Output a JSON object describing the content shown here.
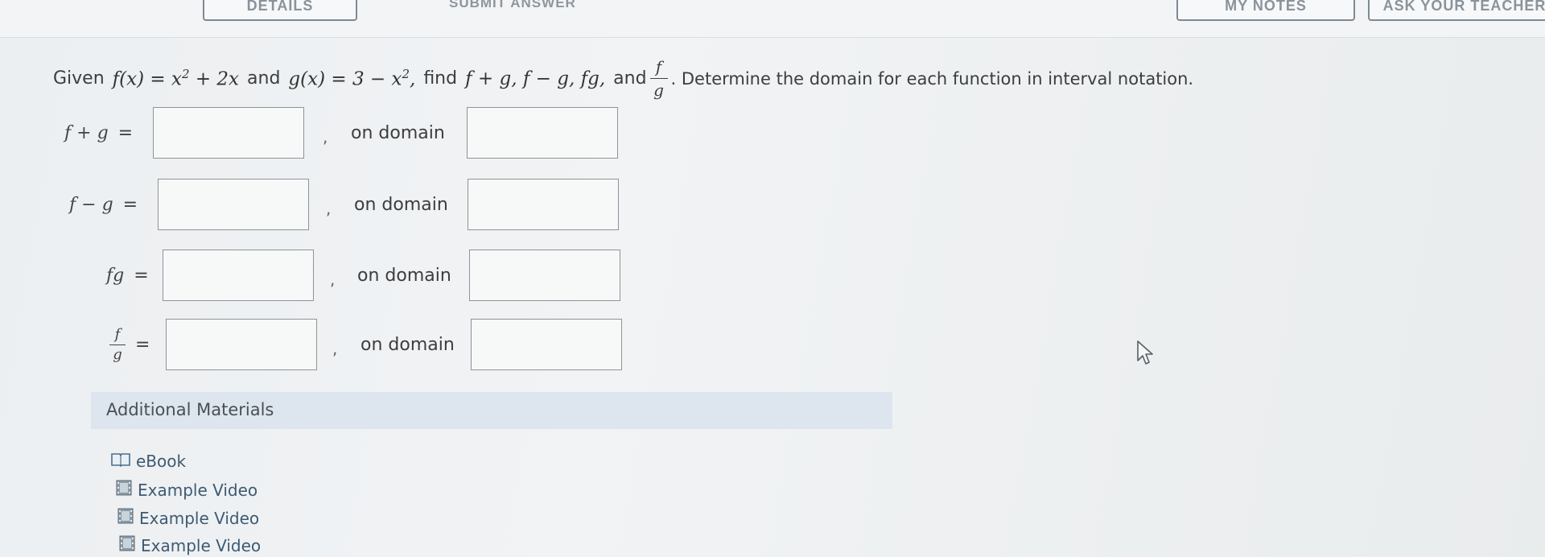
{
  "toolbar": {
    "left_button": "DETAILS",
    "center_link": "SUBMIT ANSWER",
    "right_button_1": "MY NOTES",
    "right_button_2": "ASK YOUR TEACHER"
  },
  "question": {
    "given": "Given",
    "f_def_lhs": "f(x) = x",
    "f_def_exp": "2",
    "f_def_rest": "+ 2x",
    "and1": "and",
    "g_def_lhs": "g(x) = 3 − x",
    "g_def_exp": "2",
    "g_def_rest": ",",
    "find": "find",
    "ops": "f + g, f − g, fg,",
    "and2": "and",
    "frac_num": "f",
    "frac_den": "g",
    "instruction": ". Determine the domain for each function in interval notation."
  },
  "rows": [
    {
      "label": "f + g",
      "eq": "=",
      "comma": ",",
      "domain_label": "on domain",
      "answer_value": "",
      "domain_value": ""
    },
    {
      "label": "f − g",
      "eq": "=",
      "comma": ",",
      "domain_label": "on domain",
      "answer_value": "",
      "domain_value": ""
    },
    {
      "label": "fg",
      "eq": "=",
      "comma": ",",
      "domain_label": "on domain",
      "answer_value": "",
      "domain_value": ""
    },
    {
      "label_num": "f",
      "label_den": "g",
      "eq": "=",
      "comma": ",",
      "domain_label": "on domain",
      "answer_value": "",
      "domain_value": ""
    }
  ],
  "additional_materials": {
    "title": "Additional Materials",
    "items": [
      {
        "label": "eBook",
        "icon": "book-icon"
      },
      {
        "label": "Example Video",
        "icon": "video-icon"
      },
      {
        "label": "Example Video",
        "icon": "video-icon"
      },
      {
        "label": "Example Video",
        "icon": "video-icon"
      }
    ]
  },
  "colors": {
    "link": "#3e5a72",
    "box_border": "#8e9499",
    "materials_bar": "#dde6ee"
  }
}
